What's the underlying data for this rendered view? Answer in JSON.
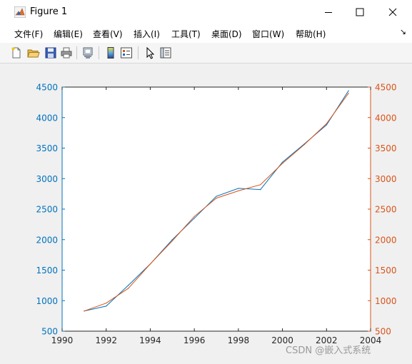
{
  "window": {
    "title": "Figure 1",
    "icon": "matlab-icon",
    "controls": {
      "minimize": "minimize-icon",
      "maximize": "maximize-icon",
      "close": "close-icon"
    }
  },
  "menubar": {
    "items": [
      {
        "label": "文件(F)"
      },
      {
        "label": "编辑(E)"
      },
      {
        "label": "查看(V)"
      },
      {
        "label": "插入(I)"
      },
      {
        "label": "工具(T)"
      },
      {
        "label": "桌面(D)"
      },
      {
        "label": "窗口(W)"
      },
      {
        "label": "帮助(H)"
      }
    ],
    "overflow_glyph": "↘"
  },
  "toolbar": {
    "items": [
      {
        "icon": "new-figure-icon"
      },
      {
        "icon": "open-file-icon"
      },
      {
        "icon": "save-icon"
      },
      {
        "icon": "print-icon"
      },
      {
        "icon": "link-plot-icon"
      },
      {
        "icon": "insert-colorbar-icon"
      },
      {
        "icon": "insert-legend-icon"
      },
      {
        "icon": "edit-plot-icon"
      },
      {
        "icon": "property-inspector-icon"
      }
    ]
  },
  "watermark": "CSDN @嵌入式系统",
  "chart_data": {
    "type": "line",
    "title": "",
    "xlabel": "",
    "ylabel": "",
    "xlim": [
      1990,
      2004
    ],
    "ylim_left": [
      500,
      4500
    ],
    "ylim_right": [
      500,
      4500
    ],
    "x_ticks": [
      1990,
      1992,
      1994,
      1996,
      1998,
      2000,
      2002,
      2004
    ],
    "y_ticks": [
      500,
      1000,
      1500,
      2000,
      2500,
      3000,
      3500,
      4000,
      4500
    ],
    "grid": false,
    "colors": {
      "left_axis": "#0072bd",
      "right_axis": "#d95319"
    },
    "series": [
      {
        "axis": "left",
        "color": "#0072bd",
        "x": [
          1991,
          1992,
          1993,
          1994,
          1995,
          1996,
          1997,
          1998,
          1999,
          2000,
          2001,
          2002,
          2003
        ],
        "values": [
          830,
          910,
          1250,
          1600,
          2000,
          2350,
          2710,
          2840,
          2820,
          3270,
          3570,
          3880,
          4440
        ]
      },
      {
        "axis": "right",
        "color": "#d95319",
        "x": [
          1991,
          1992,
          1993,
          1994,
          1995,
          1996,
          1997,
          1998,
          1999,
          2000,
          2001,
          2002,
          2003
        ],
        "values": [
          830,
          960,
          1200,
          1600,
          1980,
          2380,
          2680,
          2800,
          2900,
          3250,
          3560,
          3900,
          4400
        ]
      }
    ]
  }
}
